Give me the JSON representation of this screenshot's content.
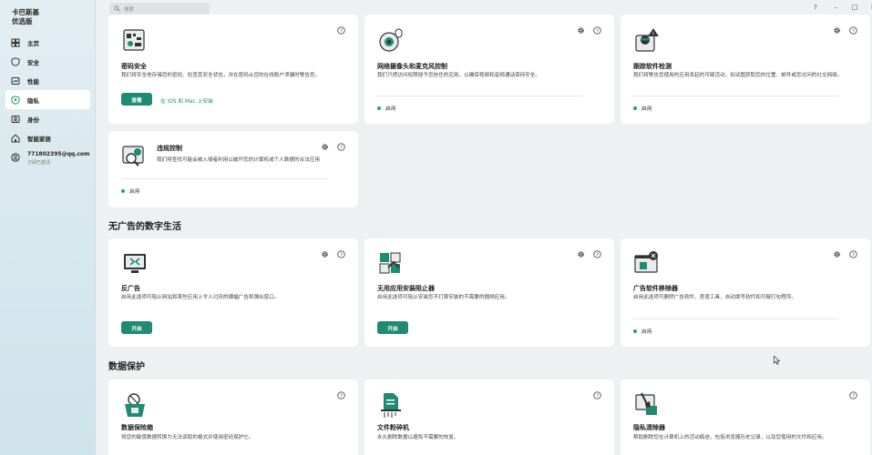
{
  "app": {
    "brand_line1": "卡巴斯基",
    "brand_line2": "优选版"
  },
  "sidebar": {
    "items": [
      {
        "label": "主页",
        "icon": "home-icon"
      },
      {
        "label": "安全",
        "icon": "shield-icon"
      },
      {
        "label": "性能",
        "icon": "performance-icon"
      },
      {
        "label": "隐私",
        "icon": "privacy-icon",
        "active": true
      },
      {
        "label": "身份",
        "icon": "identity-icon"
      },
      {
        "label": "智能家居",
        "icon": "smart-home-icon"
      }
    ],
    "user": {
      "email": "771802395@qq.com",
      "sub": "订阅已激活"
    }
  },
  "topbar": {
    "search_placeholder": "搜索",
    "help": "?",
    "minimize": "–",
    "maximize": "□",
    "close": "✕"
  },
  "sections": {
    "no_ads": "无广告的数字生活",
    "data_protection": "数据保护"
  },
  "cards": {
    "password": {
      "title": "密码安全",
      "desc": "我们将安全地存储您的密码、检查其安全状态，并在密码从您的在线账户泄漏时警告您。",
      "button": "查看",
      "link": "在 iOS 和 Mac 上安装"
    },
    "webcam": {
      "title": "网络摄像头和麦克风控制",
      "desc": "我们只把访问权限授予您信任的应用，以确保视频和音频通话保持安全。",
      "status": "启用"
    },
    "stalkerware": {
      "title": "跟踪软件检测",
      "desc": "我们将警告您使用的应用发起的可疑活动，如试图获取您的位置、邮件或您访问的社交网络。",
      "status": "启用"
    },
    "violation": {
      "title": "违规控制",
      "desc": "我们将查找可能会被入侵者利用以破坏您的计算机或个人数据的合法应用",
      "status": "启用"
    },
    "antibanner": {
      "title": "反广告",
      "desc": "启用此选项可阻止网站和某些应用上令人讨厌的横幅广告和弹出窗口。",
      "button": "开启"
    },
    "installer_blocker": {
      "title": "无用应用安装阻止器",
      "desc": "启用此选项可阻止安装您不打算安装的不需要的捆绑应用。",
      "button": "开启"
    },
    "adware_remover": {
      "title": "广告软件移除器",
      "desc": "启用此选项可删除广告软件、恶意工具、自动拨号软件和可疑打包程序。",
      "status": "启用"
    },
    "vault": {
      "title": "数据保险箱",
      "desc": "将您的敏感数据转换为无法读取的格式并使用密码保护它。"
    },
    "shredder": {
      "title": "文件粉碎机",
      "desc": "永久删除数据以避免不需要的恢复。"
    },
    "privacy_cleaner": {
      "title": "隐私清除器",
      "desc": "帮助删除您在计算机上的活动痕迹，包括浏览器历史记录，以及您使用的文件和应用。"
    }
  }
}
